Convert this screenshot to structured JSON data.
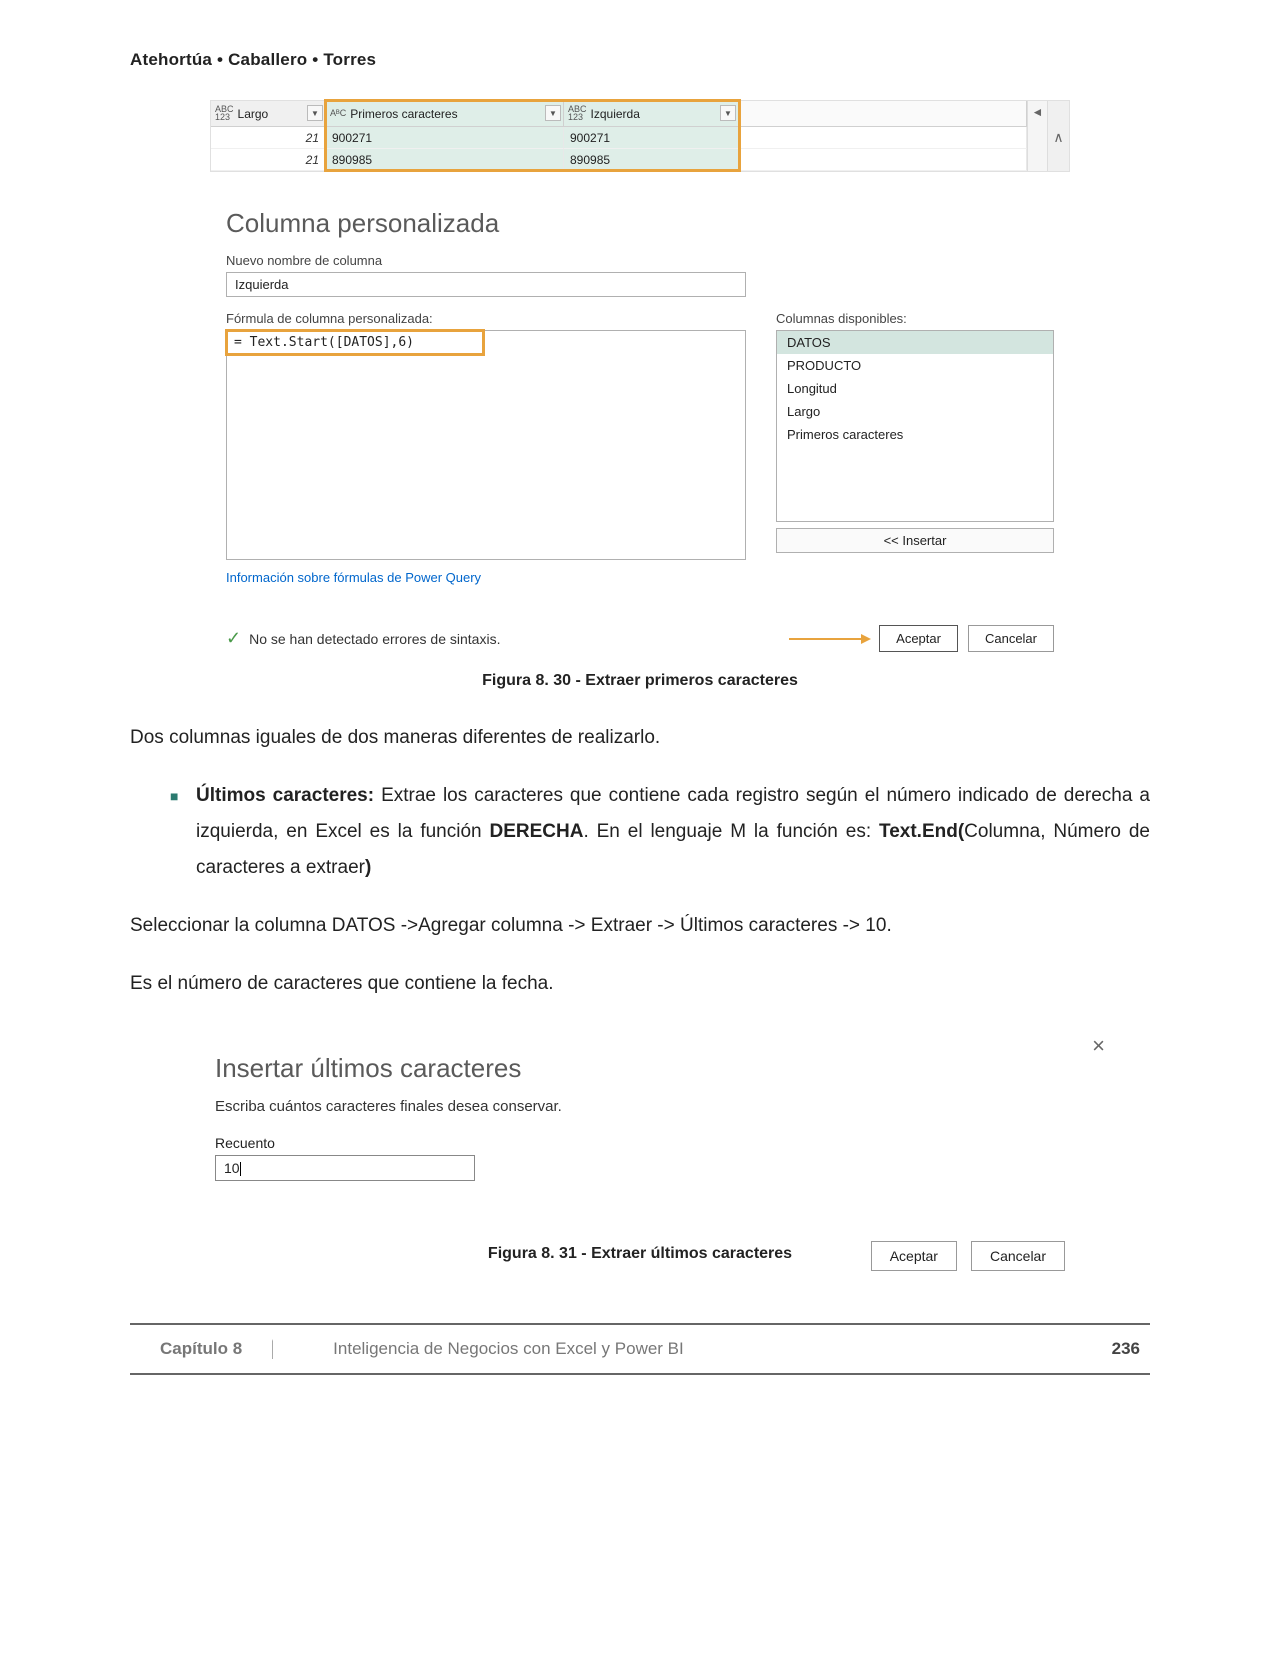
{
  "header": {
    "authors": "Atehortúa • Caballero • Torres"
  },
  "fig30": {
    "tableHeaders": {
      "largo": "Largo",
      "primeros": "Primeros caracteres",
      "izquierda": "Izquierda",
      "typeAbc123": "ABC\n123",
      "typeAbc": "AᴮC"
    },
    "rows": {
      "r1": {
        "largo": "21",
        "primeros": "900271",
        "izquierda": "900271"
      },
      "r2": {
        "largo": "21",
        "primeros": "890985",
        "izquierda": "890985"
      }
    },
    "dialog": {
      "title": "Columna personalizada",
      "newNameLabel": "Nuevo nombre de columna",
      "newNameValue": "Izquierda",
      "formulaLabel": "Fórmula de columna personalizada:",
      "formulaValue": "= Text.Start([DATOS],6)",
      "availableLabel": "Columnas disponibles:",
      "available": {
        "c1": "DATOS",
        "c2": "PRODUCTO",
        "c3": "Longitud",
        "c4": "Largo",
        "c5": "Primeros caracteres"
      },
      "insertBtn": "<< Insertar",
      "infoLink": "Información sobre fórmulas de Power Query",
      "status": "No se han detectado errores de sintaxis.",
      "accept": "Aceptar",
      "cancel": "Cancelar"
    },
    "caption": "Figura 8. 30 - Extraer primeros caracteres"
  },
  "body": {
    "p1": "Dos columnas iguales de dos maneras diferentes de realizarlo.",
    "bullet": {
      "lead": "Últimos caracteres:",
      "t1": " Extrae los caracteres que contiene  cada registro según el número indicado de derecha a izquierda, en Excel es la función ",
      "b1": "DERECHA",
      "t2": ". En el lenguaje M la función es: ",
      "b2": "Text.End(",
      "t3": "Columna, Número de caracteres a extraer",
      "b3": ")"
    },
    "p2": "Seleccionar la columna DATOS ->Agregar columna -> Extraer -> Últimos caracteres -> 10.",
    "p3": "Es el número de caracteres que contiene la fecha."
  },
  "fig31": {
    "title": "Insertar últimos caracteres",
    "sub": "Escriba cuántos caracteres finales desea conservar.",
    "countLabel": "Recuento",
    "countValue": "10",
    "accept": "Aceptar",
    "cancel": "Cancelar",
    "caption": "Figura 8. 31 - Extraer últimos caracteres"
  },
  "footer": {
    "chapter": "Capítulo 8",
    "title": "Inteligencia de Negocios con Excel y Power BI",
    "page": "236"
  }
}
